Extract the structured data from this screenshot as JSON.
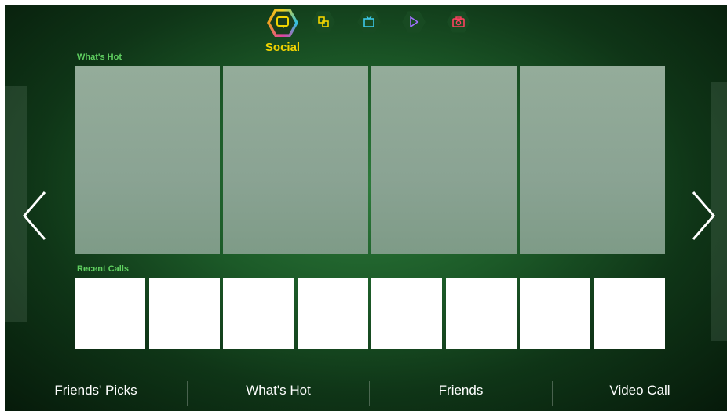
{
  "modes": [
    {
      "name": "social",
      "icon": "chat-bubble-icon",
      "active": true,
      "color": "#f2d400"
    },
    {
      "name": "apps",
      "icon": "apps-icon",
      "active": false,
      "color": "#f2d400"
    },
    {
      "name": "tv",
      "icon": "tv-icon",
      "active": false,
      "color": "#3cc8e8"
    },
    {
      "name": "movies",
      "icon": "play-icon",
      "active": false,
      "color": "#a070ff"
    },
    {
      "name": "photos",
      "icon": "camera-icon",
      "active": false,
      "color": "#ff4060"
    }
  ],
  "active_mode_label": "Social",
  "whats_hot": {
    "label": "What's Hot"
  },
  "recent_calls": {
    "label": "Recent Calls"
  },
  "bottom_nav": {
    "friends_picks": "Friends' Picks",
    "whats_hot": "What's Hot",
    "friends": "Friends",
    "video_call": "Video Call"
  },
  "colors": {
    "accent": "#f2d400",
    "section_label": "#5fcf60"
  }
}
